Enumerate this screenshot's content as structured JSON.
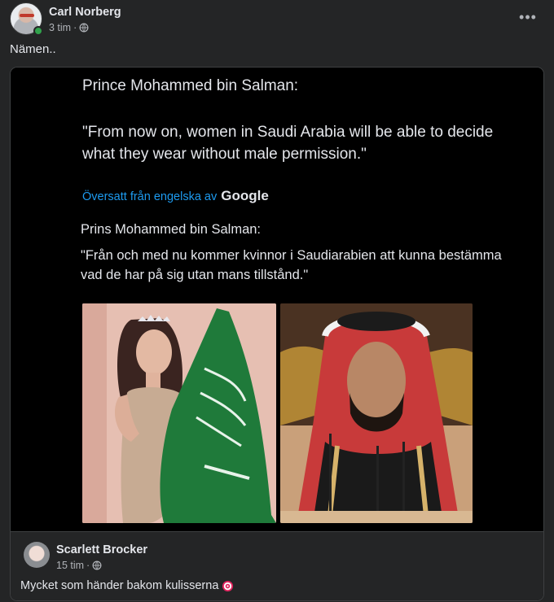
{
  "post": {
    "author": "Carl Norberg",
    "time": "3 tim",
    "separator": "·",
    "text": "Nämen..",
    "more_icon": "more-horizontal-icon"
  },
  "shared_image": {
    "quote_heading": "Prince Mohammed bin Salman:",
    "quote_text": "\"From now on, women in Saudi Arabia will be able to decide what they wear without male permission.\"",
    "translated_label": "Översatt från engelska av",
    "translated_brand": "Google",
    "translated_heading": "Prins Mohammed bin Salman:",
    "translated_text": "\"Från och med nu kommer kvinnor i Saudiarabien att kunna bestämma vad de har på sig utan mans tillstånd.\""
  },
  "shared_post": {
    "author": "Scarlett Brocker",
    "time": "15 tim",
    "separator": "·",
    "text": "Mycket som händer bakom kulisserna",
    "emoji_icon": "direct-hit-icon"
  },
  "colors": {
    "background": "#242526",
    "link_blue": "#1d9bf0",
    "online_green": "#31a24c"
  }
}
